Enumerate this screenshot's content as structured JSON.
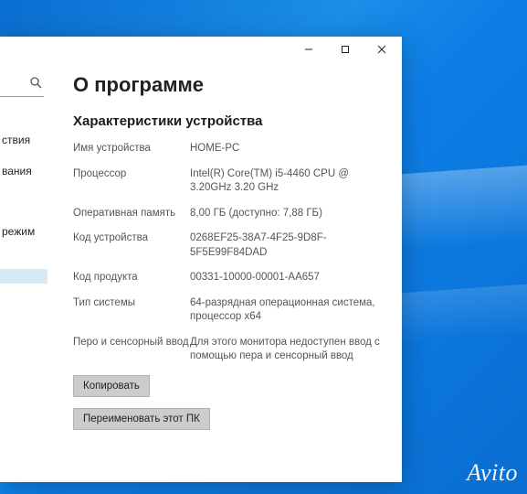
{
  "window": {
    "controls": {
      "minimize_icon": "minimize-icon",
      "maximize_icon": "maximize-icon",
      "close_icon": "close-icon"
    }
  },
  "sidebar": {
    "search_placeholder": "",
    "items": [
      {
        "label": "ствия",
        "selected": false
      },
      {
        "label": "вания",
        "selected": false
      },
      {
        "label": "режим",
        "selected": false
      },
      {
        "label": "",
        "selected": true
      }
    ]
  },
  "main": {
    "title": "О программе",
    "section_title": "Характеристики устройства",
    "specs": [
      {
        "label": "Имя устройства",
        "value": "HOME-PC"
      },
      {
        "label": "Процессор",
        "value": "Intel(R) Core(TM) i5-4460  CPU @ 3.20GHz 3.20 GHz"
      },
      {
        "label": "Оперативная память",
        "value": "8,00 ГБ (доступно: 7,88 ГБ)"
      },
      {
        "label": "Код устройства",
        "value": "0268EF25-38A7-4F25-9D8F-5F5E99F84DAD"
      },
      {
        "label": "Код продукта",
        "value": "00331-10000-00001-AA657"
      },
      {
        "label": "Тип системы",
        "value": "64-разрядная операционная система, процессор x64"
      },
      {
        "label": "Перо и сенсорный ввод",
        "value": "Для этого монитора недоступен ввод с помощью пера и сенсорный ввод"
      }
    ],
    "buttons": {
      "copy": "Копировать",
      "rename": "Переименовать этот ПК"
    }
  },
  "watermark": "Avito"
}
